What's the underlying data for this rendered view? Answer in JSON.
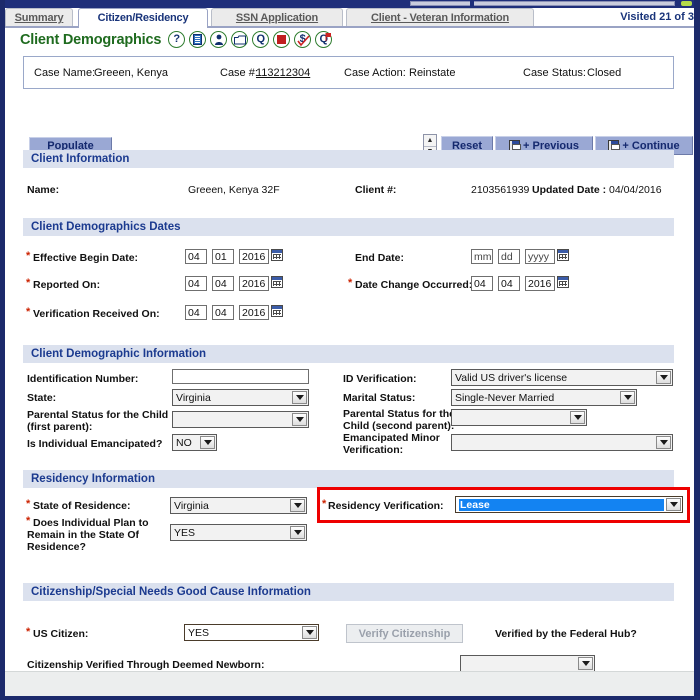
{
  "window": {
    "tabs": [
      {
        "label": "Summary",
        "active": false
      },
      {
        "label": "Citizen/Residency",
        "active": true
      },
      {
        "label": "SSN Application",
        "active": false
      },
      {
        "label": "Client - Veteran Information",
        "active": false
      }
    ],
    "visited_counter": "Visited 21 of 3"
  },
  "header": {
    "page_title": "Client Demographics",
    "icons": [
      {
        "name": "help-icon",
        "glyph": "?"
      },
      {
        "name": "document-icon",
        "glyph": "☷"
      },
      {
        "name": "person-icon",
        "glyph": "•"
      },
      {
        "name": "folder-icon",
        "glyph": ""
      },
      {
        "name": "inquiry-q-icon",
        "glyph": "Q"
      },
      {
        "name": "stop-square-icon",
        "glyph": ""
      },
      {
        "name": "dollar-check-icon",
        "glyph": "$"
      },
      {
        "name": "query-flag-icon",
        "glyph": "Q"
      }
    ]
  },
  "case_bar": {
    "case_name_label": "Case Name:",
    "case_name_value": "Greeen, Kenya",
    "case_number_label": "Case #:",
    "case_number_value": "113212304",
    "case_action_label": "Case Action:",
    "case_action_value": "Reinstate",
    "case_status_label": "Case Status:",
    "case_status_value": "Closed"
  },
  "toolbar": {
    "populate_label": "Populate",
    "spinner_up": "▲",
    "spinner_down": "▼",
    "reset_label": "Reset",
    "previous_label": "+ Previous",
    "continue_label": "+ Continue"
  },
  "client_information": {
    "section_title": "Client Information",
    "name_label": "Name:",
    "name_value": "Greeen, Kenya 32F",
    "client_number_label": "Client #:",
    "client_number_value": "2103561939",
    "updated_date_label": "Updated Date :",
    "updated_date_value": "04/04/2016"
  },
  "demographics_dates": {
    "section_title": "Client Demographics Dates",
    "effective_begin_label": "Effective Begin Date:",
    "effective_begin_mm": "04",
    "effective_begin_dd": "01",
    "effective_begin_yyyy": "2016",
    "end_date_label": "End Date:",
    "end_date_mm": "mm",
    "end_date_dd": "dd",
    "end_date_yyyy": "yyyy",
    "reported_on_label": "Reported On:",
    "reported_on_mm": "04",
    "reported_on_dd": "04",
    "reported_on_yyyy": "2016",
    "date_change_label": "Date Change Occurred:",
    "date_change_mm": "04",
    "date_change_dd": "04",
    "date_change_yyyy": "2016",
    "verification_received_label": "Verification Received On:",
    "verification_received_mm": "04",
    "verification_received_dd": "04",
    "verification_received_yyyy": "2016"
  },
  "demographic_information": {
    "section_title": "Client Demographic Information",
    "identification_number_label": "Identification Number:",
    "identification_number_value": "",
    "state_label": "State:",
    "state_value": "Virginia",
    "parental_status_first_label_line1": "Parental Status for the Child",
    "parental_status_first_label_line2": "(first parent):",
    "parental_status_first_value": "",
    "emancipated_label": "Is Individual Emancipated?",
    "emancipated_value": "NO",
    "id_verification_label": "ID Verification:",
    "id_verification_value": "Valid US driver's license",
    "marital_status_label": "Marital Status:",
    "marital_status_value": "Single-Never Married",
    "parental_status_second_label_line1": "Parental Status for the",
    "parental_status_second_label_line2": "Child (second parent):",
    "parental_status_second_value": "",
    "emancipated_minor_label_line1": "Emancipated Minor",
    "emancipated_minor_label_line2": "Verification:",
    "emancipated_minor_value": ""
  },
  "residency_information": {
    "section_title": "Residency Information",
    "state_of_residence_label": "State of Residence:",
    "state_of_residence_value": "Virginia",
    "plan_to_remain_label_line1": "Does Individual Plan to",
    "plan_to_remain_label_line2": "Remain in the State Of",
    "plan_to_remain_label_line3": "Residence?",
    "plan_to_remain_value": "YES",
    "residency_verification_label": "Residency Verification:",
    "residency_verification_value": "Lease",
    "highlight_color": "#ee0000"
  },
  "citizenship_information": {
    "section_title": "Citizenship/Special Needs Good Cause Information",
    "us_citizen_label": "US Citizen:",
    "us_citizen_value": "YES",
    "verify_citizenship_label": "Verify Citizenship",
    "federal_hub_label": "Verified by the Federal Hub?",
    "deemed_newborn_label": "Citizenship Verified Through Deemed Newborn:",
    "deemed_newborn_value": ""
  }
}
